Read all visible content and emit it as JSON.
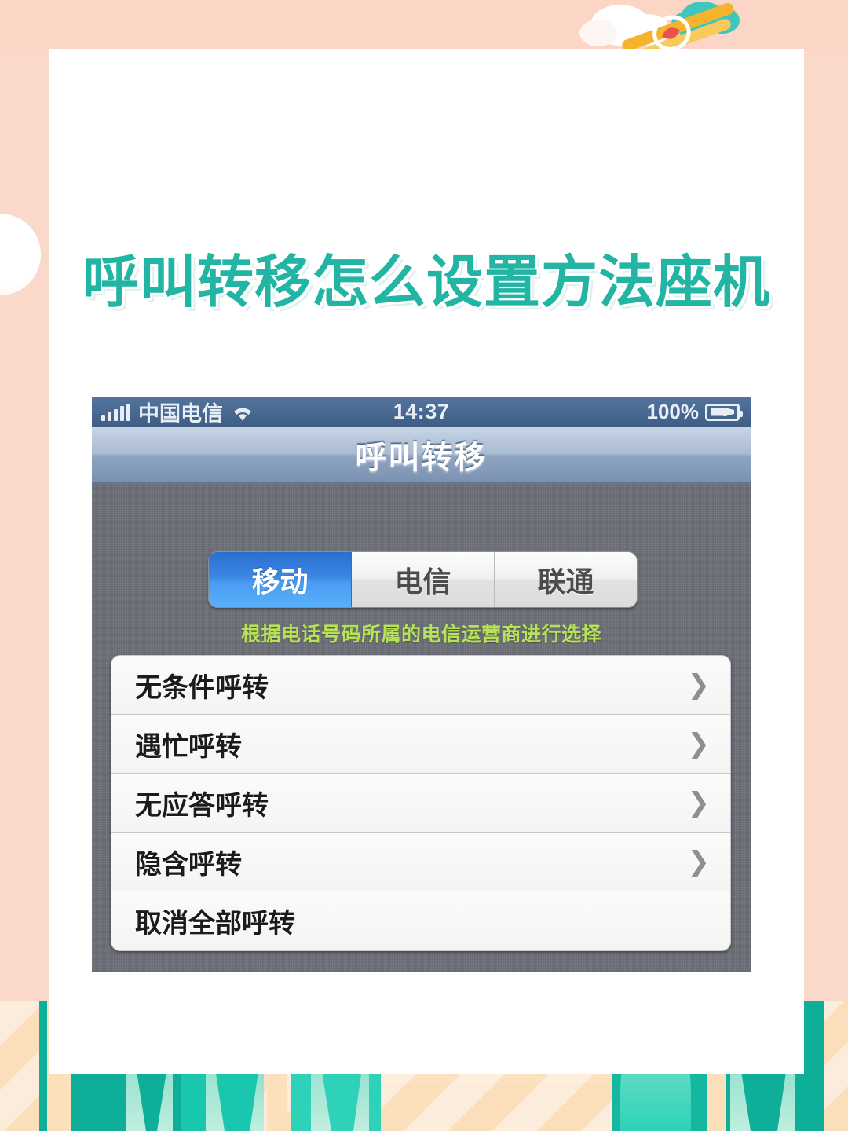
{
  "headline": "呼叫转移怎么设置方法座机",
  "theme": {
    "background": "#fbd9ca",
    "card": "#ffffff",
    "headline_color": "#22b5a4",
    "accent_blue": "#3b87e4",
    "hint_green": "#b6e356",
    "app_bg": "#6e7179"
  },
  "decorations": {
    "plane": "airplane-icon",
    "cloud": "cloud-icon",
    "circle": "circle-shape",
    "grass": "grass-blades"
  },
  "phone": {
    "statusbar": {
      "signal": "signal-bars-icon",
      "carrier": "中国电信",
      "wifi": "wifi-icon",
      "time": "14:37",
      "battery_percent": "100%",
      "battery": "battery-charging-icon"
    },
    "navbar": {
      "title": "呼叫转移"
    },
    "segmented": {
      "options": [
        {
          "label": "移动",
          "selected": true
        },
        {
          "label": "电信",
          "selected": false
        },
        {
          "label": "联通",
          "selected": false
        }
      ],
      "hint": "根据电话号码所属的电信运营商进行选择"
    },
    "list": {
      "rows": [
        {
          "label": "无条件呼转",
          "chevron": true
        },
        {
          "label": "遇忙呼转",
          "chevron": true
        },
        {
          "label": "无应答呼转",
          "chevron": true
        },
        {
          "label": "隐含呼转",
          "chevron": true
        },
        {
          "label": "取消全部呼转",
          "chevron": false
        }
      ]
    }
  }
}
